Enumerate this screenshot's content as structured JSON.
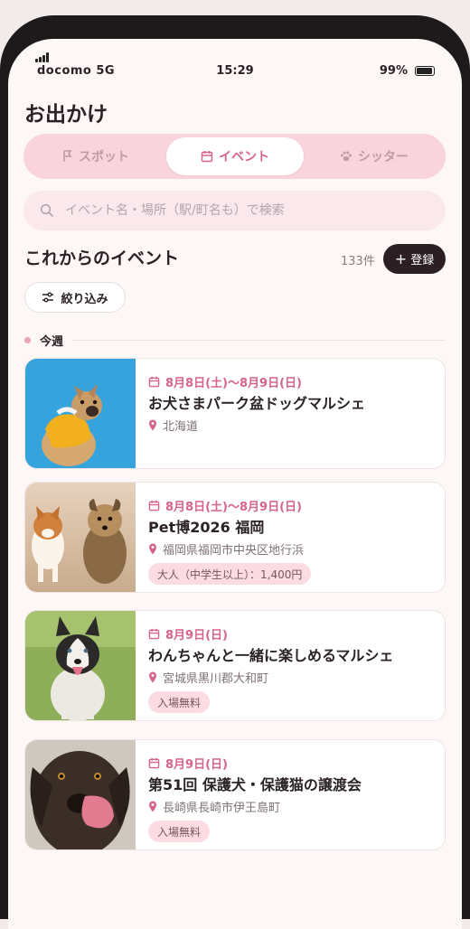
{
  "status": {
    "carrier": "docomo  5G",
    "time": "15:29",
    "battery": "99%"
  },
  "page_title": "お出かけ",
  "tabs": [
    {
      "label": "スポット",
      "icon": "flag-icon",
      "active": false
    },
    {
      "label": "イベント",
      "icon": "calendar-icon",
      "active": true
    },
    {
      "label": "シッター",
      "icon": "paw-icon",
      "active": false
    }
  ],
  "search": {
    "placeholder": "イベント名・場所（駅/町名も）で検索"
  },
  "section": {
    "title": "これからのイベント",
    "count": "133件",
    "add_label": "登録"
  },
  "filter": {
    "label": "絞り込み"
  },
  "week_label": "今週",
  "colors": {
    "accent": "#d6648a",
    "tab_bg": "#f9d4dd",
    "badge_bg": "#fbdce3",
    "dark_button": "#2b1f24"
  },
  "events": [
    {
      "date": "8月8日(土)〜8月9日(日)",
      "title": "お犬さまパーク盆ドッグマルシェ",
      "location": "北海道",
      "badge": "",
      "image": "french-bulldog-photo"
    },
    {
      "date": "8月8日(土)〜8月9日(日)",
      "title": "Pet博2026 福岡",
      "location": "福岡県福岡市中央区地行浜",
      "badge": "大人（中学生以上）：1,400円",
      "image": "corgi-and-yorkie-photo"
    },
    {
      "date": "8月9日(日)",
      "title": "わんちゃんと一緒に楽しめるマルシェ",
      "location": "宮城県黒川郡大和町",
      "badge": "入場無料",
      "image": "husky-photo"
    },
    {
      "date": "8月9日(日)",
      "title": "第51回 保護犬・保護猫の譲渡会",
      "location": "長崎県長崎市伊王島町",
      "badge": "入場無料",
      "image": "labrador-photo"
    }
  ]
}
